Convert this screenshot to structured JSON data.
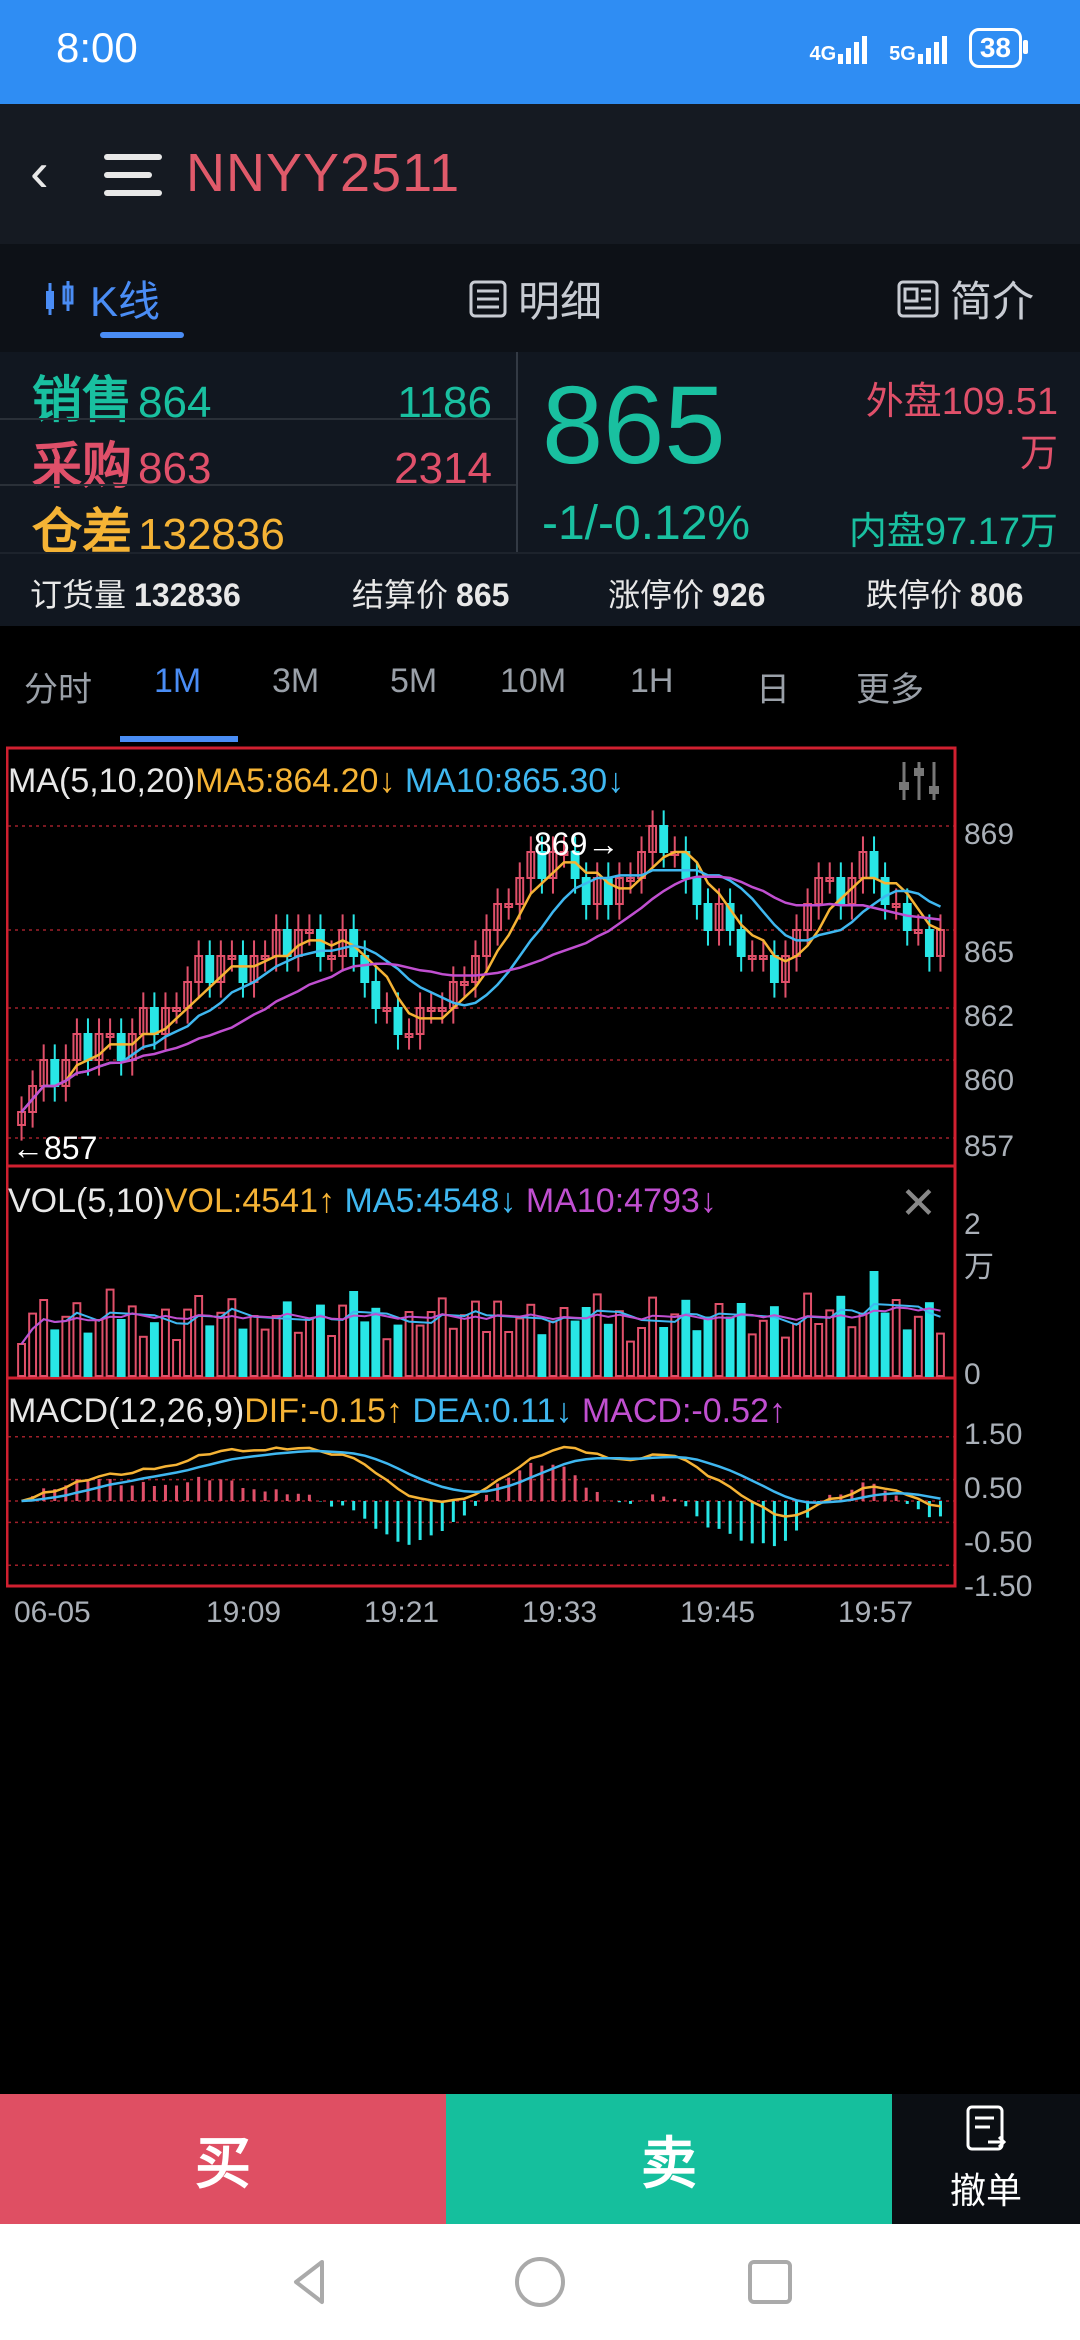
{
  "status": {
    "time": "8:00",
    "sig1": "4G",
    "sig2": "5G",
    "battery": "38"
  },
  "header": {
    "title": "NNYY2511"
  },
  "tabs": [
    {
      "label": "K线",
      "icon": "candle-icon"
    },
    {
      "label": "明细",
      "icon": "list-icon"
    },
    {
      "label": "简介",
      "icon": "doc-icon"
    }
  ],
  "quote": {
    "sell_label": "销售",
    "sell_price": "864",
    "sell_vol": "1186",
    "buy_label": "采购",
    "buy_price": "863",
    "buy_vol": "2314",
    "diff_label": "仓差",
    "diff_val": "132836",
    "last": "865",
    "change": "-1/-0.12%",
    "outer_label": "外盘109.51",
    "outer_unit": "万",
    "inner": "内盘97.17万",
    "colors": {
      "up": "#e0506a",
      "down": "#19c0a0",
      "warn": "#f5b335"
    }
  },
  "info": [
    {
      "label": "订货量",
      "value": "132836"
    },
    {
      "label": "结算价",
      "value": "865"
    },
    {
      "label": "涨停价",
      "value": "926"
    },
    {
      "label": "跌停价",
      "value": "806"
    }
  ],
  "periods": [
    "分时",
    "1M",
    "3M",
    "5M",
    "10M",
    "1H",
    "日",
    "更多"
  ],
  "active_period": "1M",
  "indicators": {
    "ma": {
      "name": "MA(5,10,20)",
      "ma5": "MA5:864.20↓",
      "ma10": "MA10:865.30↓"
    },
    "vol": {
      "name": "VOL(5,10)",
      "vol": "VOL:4541↑",
      "ma5": "MA5:4548↓",
      "ma10": "MA10:4793↓"
    },
    "macd": {
      "name": "MACD(12,26,9)",
      "dif": "DIF:-0.15↑",
      "dea": "DEA:0.11↓",
      "macd": "MACD:-0.52↑"
    }
  },
  "annotations": {
    "high": "869→",
    "low": "←857"
  },
  "price_ticks": [
    "869",
    "865",
    "862",
    "860",
    "857"
  ],
  "vol_ticks": [
    "2万",
    "0"
  ],
  "macd_ticks": [
    "1.50",
    "0.50",
    "-0.50",
    "-1.50"
  ],
  "time_ticks": [
    "06-05",
    "19:09",
    "19:21",
    "19:33",
    "19:45",
    "19:57"
  ],
  "chart_data": {
    "type": "candlestick",
    "price_range": [
      856.6,
      869.1
    ],
    "closes": [
      858,
      859,
      860,
      859,
      860,
      861,
      860,
      861,
      861,
      860,
      861,
      862,
      861,
      862,
      862,
      863,
      864,
      863,
      864,
      864,
      863,
      864,
      864,
      865,
      864,
      865,
      865,
      864,
      864,
      865,
      864,
      863,
      862,
      862,
      861,
      861,
      862,
      862,
      862,
      863,
      863,
      864,
      865,
      866,
      866,
      867,
      868,
      867,
      868,
      868,
      867,
      866,
      867,
      866,
      867,
      867,
      868,
      869,
      868,
      868,
      867,
      866,
      865,
      866,
      865,
      864,
      864,
      864,
      863,
      864,
      865,
      866,
      867,
      867,
      866,
      867,
      868,
      867,
      866,
      866,
      865,
      865,
      864,
      865
    ],
    "vol_range": [
      0,
      20000
    ],
    "macd_range": [
      -1.75,
      1.75
    ]
  },
  "buttons": {
    "buy": "买",
    "sell": "卖",
    "cancel": "撤单"
  }
}
